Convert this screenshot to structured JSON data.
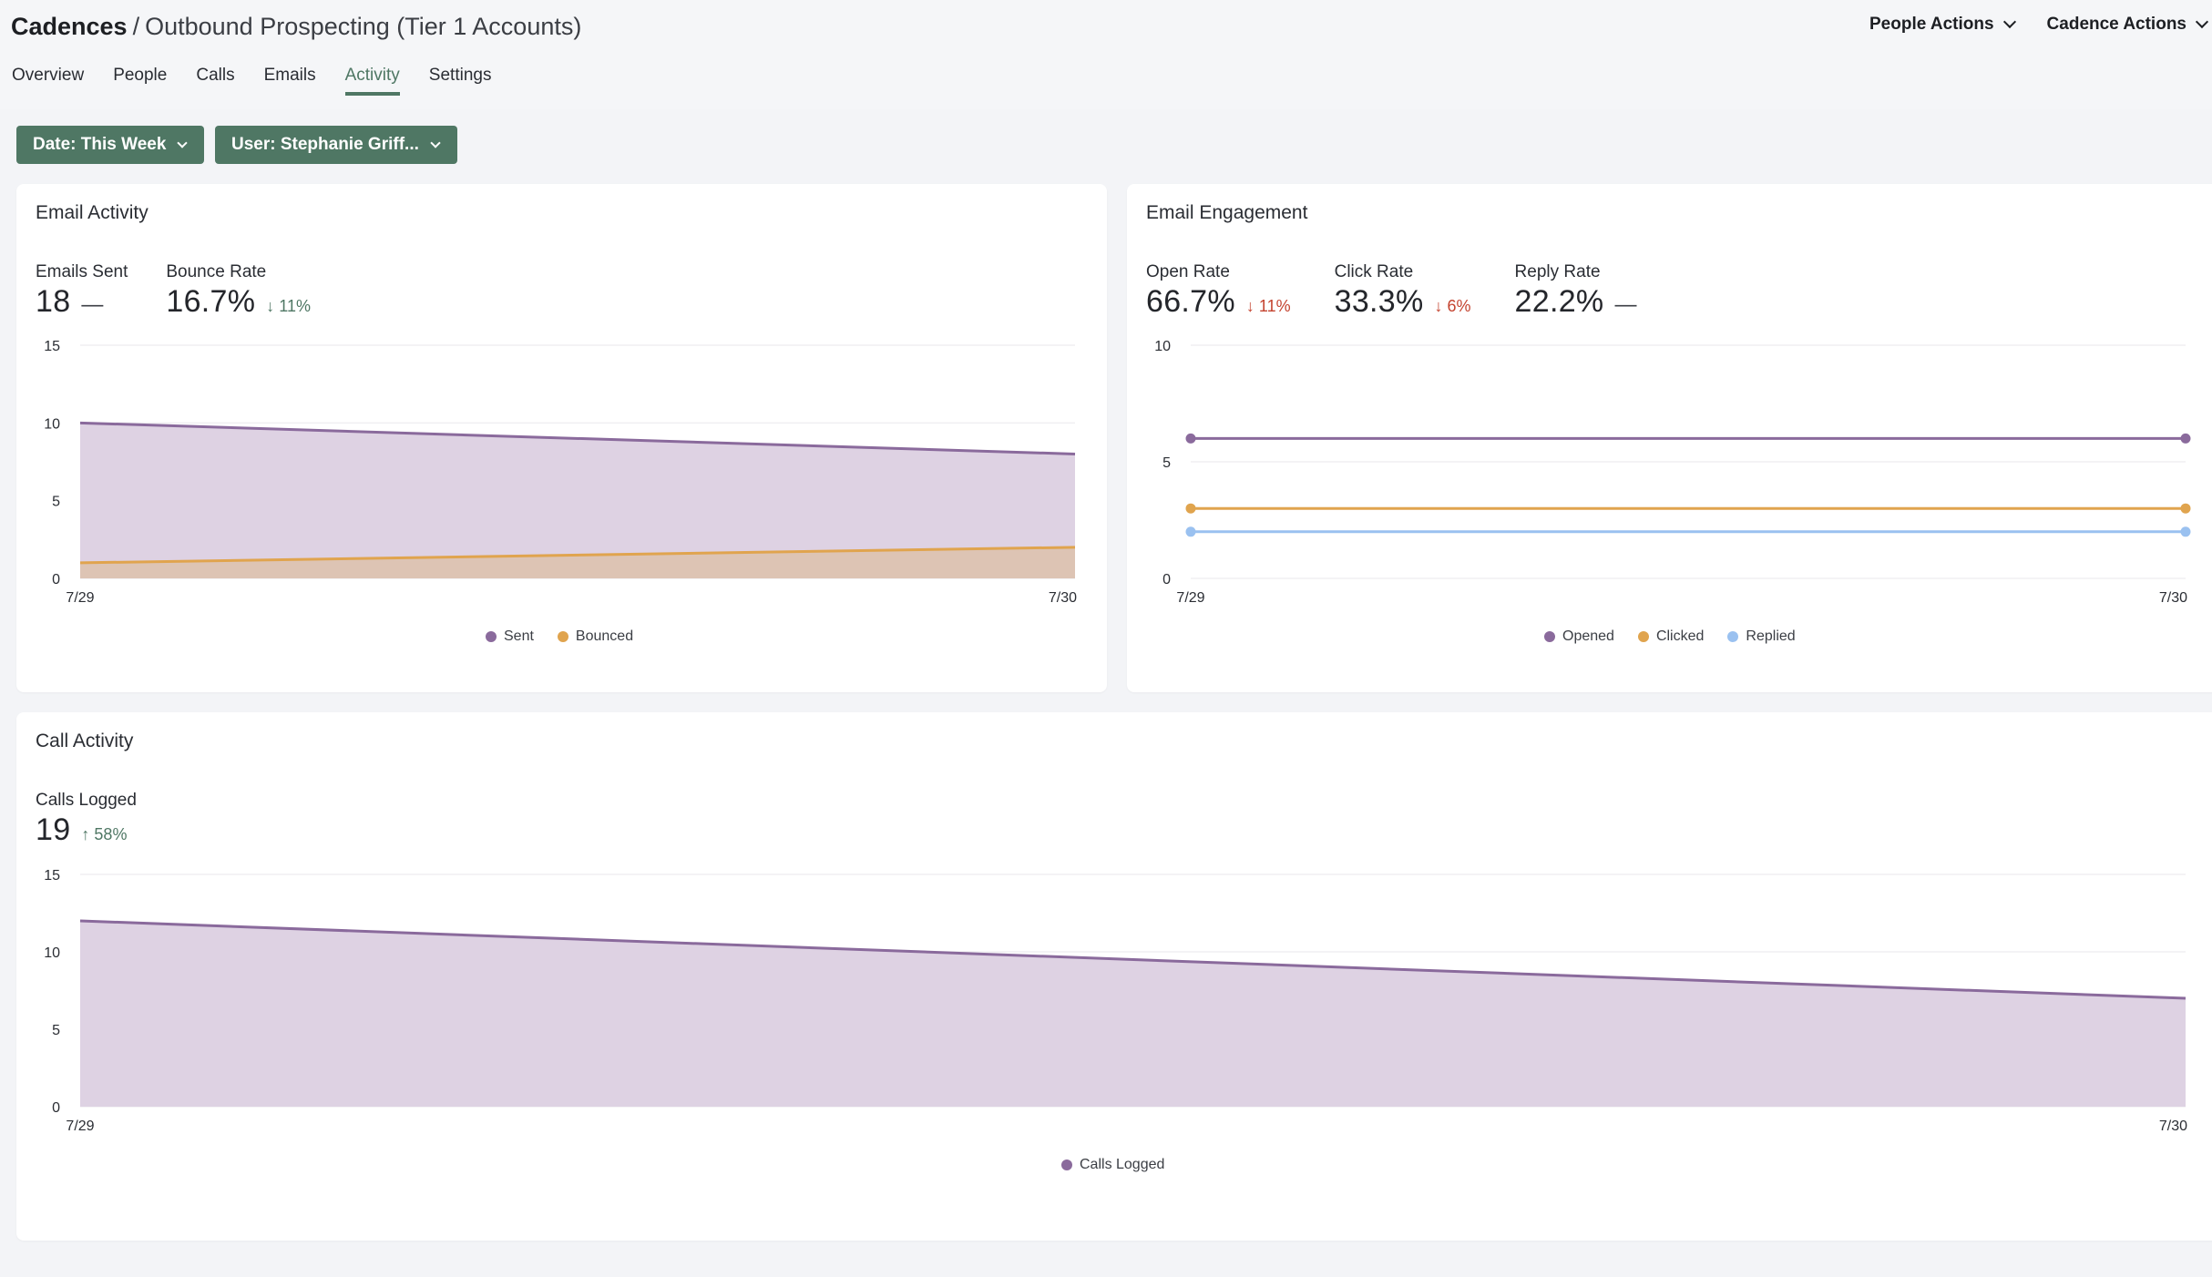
{
  "header": {
    "breadcrumb_root": "Cadences",
    "separator": "/",
    "cadence_name": "Outbound Prospecting (Tier 1 Accounts)",
    "actions": [
      {
        "label": "People Actions",
        "icon": "chevron-down-icon"
      },
      {
        "label": "Cadence Actions",
        "icon": "chevron-down-icon"
      }
    ]
  },
  "tabs": [
    {
      "label": "Overview",
      "active": false
    },
    {
      "label": "People",
      "active": false
    },
    {
      "label": "Calls",
      "active": false
    },
    {
      "label": "Emails",
      "active": false
    },
    {
      "label": "Activity",
      "active": true
    },
    {
      "label": "Settings",
      "active": false
    }
  ],
  "filters": {
    "date": "Date: This Week",
    "user": "User: Stephanie Griff..."
  },
  "colors": {
    "accent": "#4f7764",
    "negative": "#c4432f",
    "purple": "#8a6a9c",
    "orange": "#e0a44e",
    "blue": "#9ac1f0"
  },
  "email_activity": {
    "title": "Email Activity",
    "stats": [
      {
        "label": "Emails Sent",
        "value": "18",
        "delta": "—",
        "trend": "neutral"
      },
      {
        "label": "Bounce Rate",
        "value": "16.7%",
        "delta": "↓ 11%",
        "trend": "good"
      }
    ]
  },
  "email_engagement": {
    "title": "Email Engagement",
    "stats": [
      {
        "label": "Open Rate",
        "value": "66.7%",
        "delta": "↓ 11%",
        "trend": "bad"
      },
      {
        "label": "Click Rate",
        "value": "33.3%",
        "delta": "↓ 6%",
        "trend": "bad"
      },
      {
        "label": "Reply Rate",
        "value": "22.2%",
        "delta": "—",
        "trend": "neutral"
      }
    ]
  },
  "call_activity": {
    "title": "Call Activity",
    "stats": [
      {
        "label": "Calls Logged",
        "value": "19",
        "delta": "↑ 58%",
        "trend": "good"
      }
    ]
  },
  "chart_data": [
    {
      "id": "email-activity-chart",
      "type": "area",
      "title": "Email Activity",
      "x": [
        "7/29",
        "7/30"
      ],
      "yticks": [
        0,
        5,
        10,
        15
      ],
      "ylim": [
        0,
        15
      ],
      "grid": true,
      "legend": "bottom-center",
      "series": [
        {
          "name": "Sent",
          "values": [
            10,
            8
          ],
          "color": "#8a6a9c",
          "fill": "#dcd0e1"
        },
        {
          "name": "Bounced",
          "values": [
            1,
            2
          ],
          "color": "#e0a44e",
          "fill": "#dcc3b1"
        }
      ]
    },
    {
      "id": "email-engagement-chart",
      "type": "line",
      "title": "Email Engagement",
      "x": [
        "7/29",
        "7/30"
      ],
      "yticks": [
        0,
        5,
        10
      ],
      "ylim": [
        0,
        10
      ],
      "grid": true,
      "legend": "bottom-center",
      "series": [
        {
          "name": "Opened",
          "values": [
            6,
            6
          ],
          "color": "#8a6a9c"
        },
        {
          "name": "Clicked",
          "values": [
            3,
            3
          ],
          "color": "#e0a44e"
        },
        {
          "name": "Replied",
          "values": [
            2,
            2
          ],
          "color": "#9ac1f0"
        }
      ]
    },
    {
      "id": "call-activity-chart",
      "type": "area",
      "title": "Call Activity",
      "x": [
        "7/29",
        "7/30"
      ],
      "yticks": [
        0,
        5,
        10,
        15
      ],
      "ylim": [
        0,
        15
      ],
      "grid": true,
      "legend": "bottom-center",
      "series": [
        {
          "name": "Calls Logged",
          "values": [
            12,
            7
          ],
          "color": "#8a6a9c",
          "fill": "#dcd0e1"
        }
      ]
    }
  ]
}
